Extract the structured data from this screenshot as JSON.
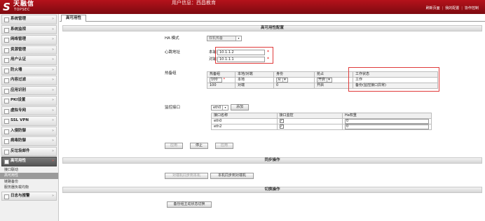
{
  "header": {
    "logo_mark": "S",
    "logo_cn": "天融信",
    "logo_en": "TOPSEC",
    "user_info": "用户信息：西昌教育",
    "links": [
      "刷新页面",
      "我的配置",
      "协作控制"
    ]
  },
  "sidebar": {
    "items": [
      {
        "label": "系统管理"
      },
      {
        "label": "系统监视"
      },
      {
        "label": "网络管理"
      },
      {
        "label": "资源管理"
      },
      {
        "label": "用户认证"
      },
      {
        "label": "防火墙"
      },
      {
        "label": "内容过滤"
      },
      {
        "label": "应用识别"
      },
      {
        "label": "PKI设置"
      },
      {
        "label": "虚拟专网"
      },
      {
        "label": "SSL VPN"
      },
      {
        "label": "入侵防御"
      },
      {
        "label": "病毒防御"
      },
      {
        "label": "反垃圾邮件"
      }
    ],
    "active": {
      "label": "高可用性"
    },
    "sub_items": [
      {
        "label": "接口联动"
      },
      {
        "label": "高可用性"
      },
      {
        "label": "链路备份"
      },
      {
        "label": "服务器负载均衡"
      }
    ],
    "last": {
      "label": "日志与报警"
    },
    "arrow": "»"
  },
  "main": {
    "tab": "高可用性",
    "config_title": "高可用性配置",
    "ha_mode_label": "HA 模式",
    "ha_mode_value": "双机热备",
    "heartbeat_label": "心跳地址",
    "local_label": "本端",
    "local_value": "10.1.1.2",
    "peer_label": "对端",
    "peer_value": "10.1.1.1",
    "required_mark": "*",
    "hotgroup_label": "热备组",
    "hotgroup_headers": [
      "热备组",
      "本地/对端",
      "身份",
      "抢占",
      "工作状态"
    ],
    "hotgroup_rows": [
      {
        "group": "100",
        "side": "本地",
        "role": "从",
        "preempt": "开启",
        "status": "工作"
      },
      {
        "group": "100",
        "side": "对端",
        "role": "0",
        "preempt": "开启",
        "status": "备份(监控接口异常)"
      }
    ],
    "monitor_label": "监控接口",
    "monitor_select": "eth0",
    "add_button": "添加",
    "monitor_headers": [
      "接口名称",
      "接口监控",
      "Ha权重"
    ],
    "monitor_rows": [
      {
        "name": "eth0",
        "checked": "✓",
        "weight": "0"
      },
      {
        "name": "eth2",
        "checked": "✓",
        "weight": "0"
      }
    ],
    "buttons": {
      "apply": "应用",
      "stop": "停止",
      "apply2": "应用"
    },
    "sync_title": "同步操作",
    "sync_peer_to_local": "对端机同步到本机",
    "sync_local_to_peer": "本机同步到对端机",
    "switch_title": "切换操作",
    "switch_button": "备份组主动状态切换",
    "dropdown_glyph": "▾"
  },
  "colors": {
    "header": "#b5121b",
    "highlight": "#e03a3a"
  }
}
